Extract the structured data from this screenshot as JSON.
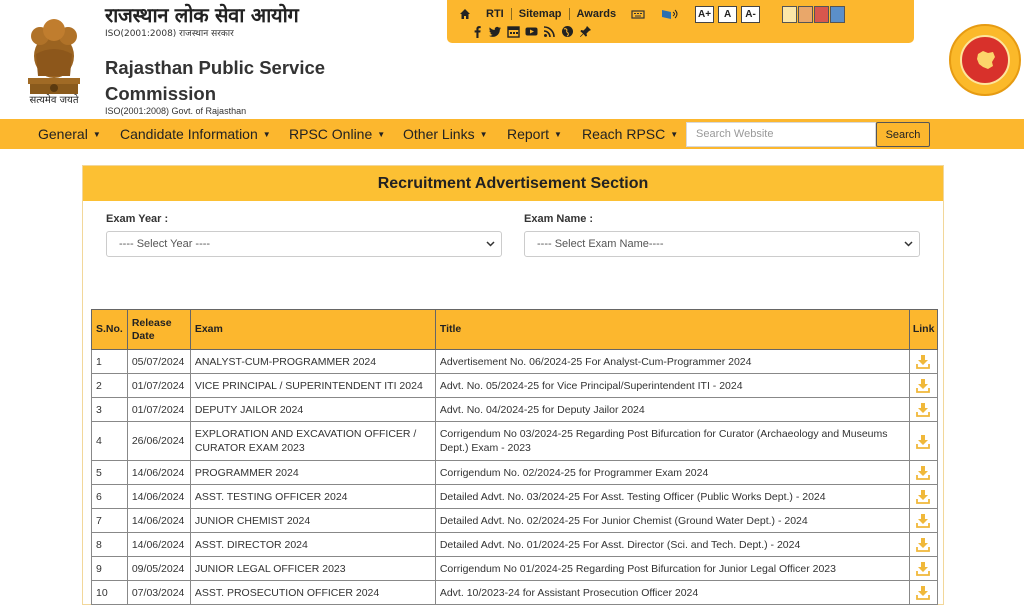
{
  "header": {
    "title_hi": "राजस्थान लोक सेवा आयोग",
    "iso_hi": "ISO(2001:2008) राजस्थान सरकार",
    "title_en": "Rajasthan Public Service Commission",
    "iso_en": "ISO(2001:2008) Govt. of Rajasthan",
    "emblem_motto": "सत्यमेव जयते"
  },
  "toolbar": {
    "links": [
      "RTI",
      "Sitemap",
      "Awards"
    ],
    "font_buttons": [
      "A+",
      "A",
      "A-"
    ],
    "swatches": [
      "#fce7a8",
      "#e9a76a",
      "#d8574d",
      "#5b8fc9"
    ],
    "social_icons": [
      "facebook-icon",
      "twitter-icon",
      "calendar-icon",
      "youtube-icon",
      "rss-icon",
      "globe-icon",
      "pin-icon"
    ]
  },
  "nav": {
    "items": [
      "General",
      "Candidate Information",
      "RPSC Online",
      "Other Links",
      "Report",
      "Reach RPSC"
    ],
    "search_placeholder": "Search Website",
    "search_button": "Search"
  },
  "section": {
    "title": "Recruitment Advertisement Section",
    "exam_year_label": "Exam Year :",
    "exam_year_value": "---- Select Year ----",
    "exam_name_label": "Exam Name :",
    "exam_name_value": "---- Select Exam Name----"
  },
  "table": {
    "headers": [
      "S.No.",
      "Release Date",
      "Exam",
      "Title",
      "Link"
    ],
    "rows": [
      {
        "sno": "1",
        "date": "05/07/2024",
        "exam": "ANALYST-CUM-PROGRAMMER 2024",
        "title": "Advertisement No. 06/2024-25 For Analyst-Cum-Programmer 2024"
      },
      {
        "sno": "2",
        "date": "01/07/2024",
        "exam": "VICE PRINCIPAL / SUPERINTENDENT ITI 2024",
        "title": "Advt. No. 05/2024-25 for Vice Principal/Superintendent ITI - 2024"
      },
      {
        "sno": "3",
        "date": "01/07/2024",
        "exam": "DEPUTY JAILOR 2024",
        "title": "Advt. No. 04/2024-25 for Deputy Jailor 2024"
      },
      {
        "sno": "4",
        "date": "26/06/2024",
        "exam": "EXPLORATION AND EXCAVATION OFFICER / CURATOR EXAM 2023",
        "title": "Corrigendum No 03/2024-25 Regarding Post Bifurcation for Curator (Archaeology and Museums Dept.) Exam - 2023"
      },
      {
        "sno": "5",
        "date": "14/06/2024",
        "exam": "PROGRAMMER 2024",
        "title": "Corrigendum No. 02/2024-25 for Programmer Exam 2024"
      },
      {
        "sno": "6",
        "date": "14/06/2024",
        "exam": "ASST. TESTING OFFICER 2024",
        "title": "Detailed Advt. No. 03/2024-25 For Asst. Testing Officer (Public Works Dept.) - 2024"
      },
      {
        "sno": "7",
        "date": "14/06/2024",
        "exam": "JUNIOR CHEMIST 2024",
        "title": "Detailed Advt. No. 02/2024-25 For Junior Chemist (Ground Water Dept.) - 2024"
      },
      {
        "sno": "8",
        "date": "14/06/2024",
        "exam": "ASST. DIRECTOR 2024",
        "title": "Detailed Advt. No. 01/2024-25 For Asst. Director (Sci. and Tech. Dept.) - 2024"
      },
      {
        "sno": "9",
        "date": "09/05/2024",
        "exam": "JUNIOR LEGAL OFFICER 2023",
        "title": "Corrigendum No 01/2024-25 Regarding Post Bifurcation for Junior Legal Officer 2023"
      },
      {
        "sno": "10",
        "date": "07/03/2024",
        "exam": "ASST. PROSECUTION OFFICER 2024",
        "title": "Advt. 10/2023-24 for Assistant Prosecution Officer 2024"
      }
    ]
  }
}
